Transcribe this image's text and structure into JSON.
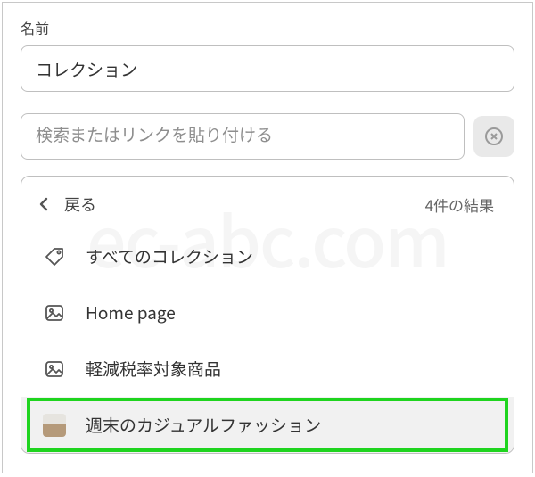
{
  "watermark": "ec-abc.com",
  "field": {
    "label": "名前",
    "value": "コレクション"
  },
  "search": {
    "placeholder": "検索またはリンクを貼り付ける",
    "value": ""
  },
  "dropdown": {
    "back_label": "戻る",
    "results_text": "4件の結果",
    "items": [
      {
        "icon": "tag-icon",
        "label": "すべてのコレクション"
      },
      {
        "icon": "image-icon",
        "label": "Home page"
      },
      {
        "icon": "image-icon",
        "label": "軽減税率対象商品"
      },
      {
        "icon": "thumb",
        "label": "週末のカジュアルファッション",
        "selected": true
      }
    ]
  }
}
